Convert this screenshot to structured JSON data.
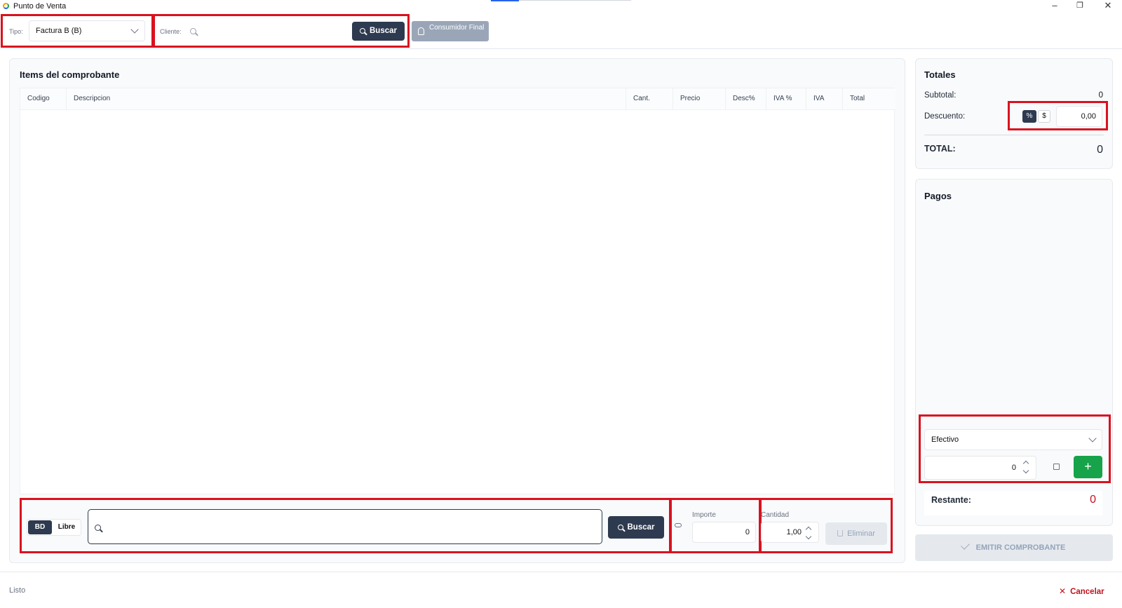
{
  "window": {
    "title": "Punto de Venta",
    "controls": {
      "minimize": "–",
      "maximize": "❐",
      "close": "✕"
    }
  },
  "toolbar": {
    "tipo_label": "Tipo:",
    "tipo_value": "Factura B (B)",
    "cliente_label": "Cliente:",
    "cliente_placeholder": "",
    "buscar_label": "Buscar",
    "consumidor_final_label": "Consumidor Final"
  },
  "items": {
    "title": "Items del comprobante",
    "columns": [
      "Codigo",
      "Descripcion",
      "Cant.",
      "Precio",
      "Desc%",
      "IVA %",
      "IVA",
      "Total"
    ],
    "rows": []
  },
  "entry_bar": {
    "mode_bd": "BD",
    "mode_libre": "Libre",
    "search_value": "",
    "buscar_label": "Buscar",
    "importe_label": "Importe",
    "importe_value": "0",
    "cantidad_label": "Cantidad",
    "cantidad_value": "1,00",
    "eliminar_label": "Eliminar"
  },
  "totales": {
    "title": "Totales",
    "subtotal_label": "Subtotal:",
    "subtotal_value": "0",
    "descuento_label": "Descuento:",
    "descuento_pct": "%",
    "descuento_usd": "$",
    "descuento_value": "0,00",
    "total_label": "TOTAL:",
    "total_value": "0"
  },
  "pagos": {
    "title": "Pagos",
    "method": "Efectivo",
    "amount": "0",
    "add_label": "+",
    "restante_label": "Restante:",
    "restante_value": "0"
  },
  "emitir_label": "EMITIR COMPROBANTE",
  "status": {
    "text": "Listo",
    "cancel_label": "Cancelar"
  },
  "colors": {
    "accent_dark": "#2e3a4f",
    "highlight": "#d9121f",
    "success": "#16a34a",
    "danger_text": "#c1121f"
  }
}
